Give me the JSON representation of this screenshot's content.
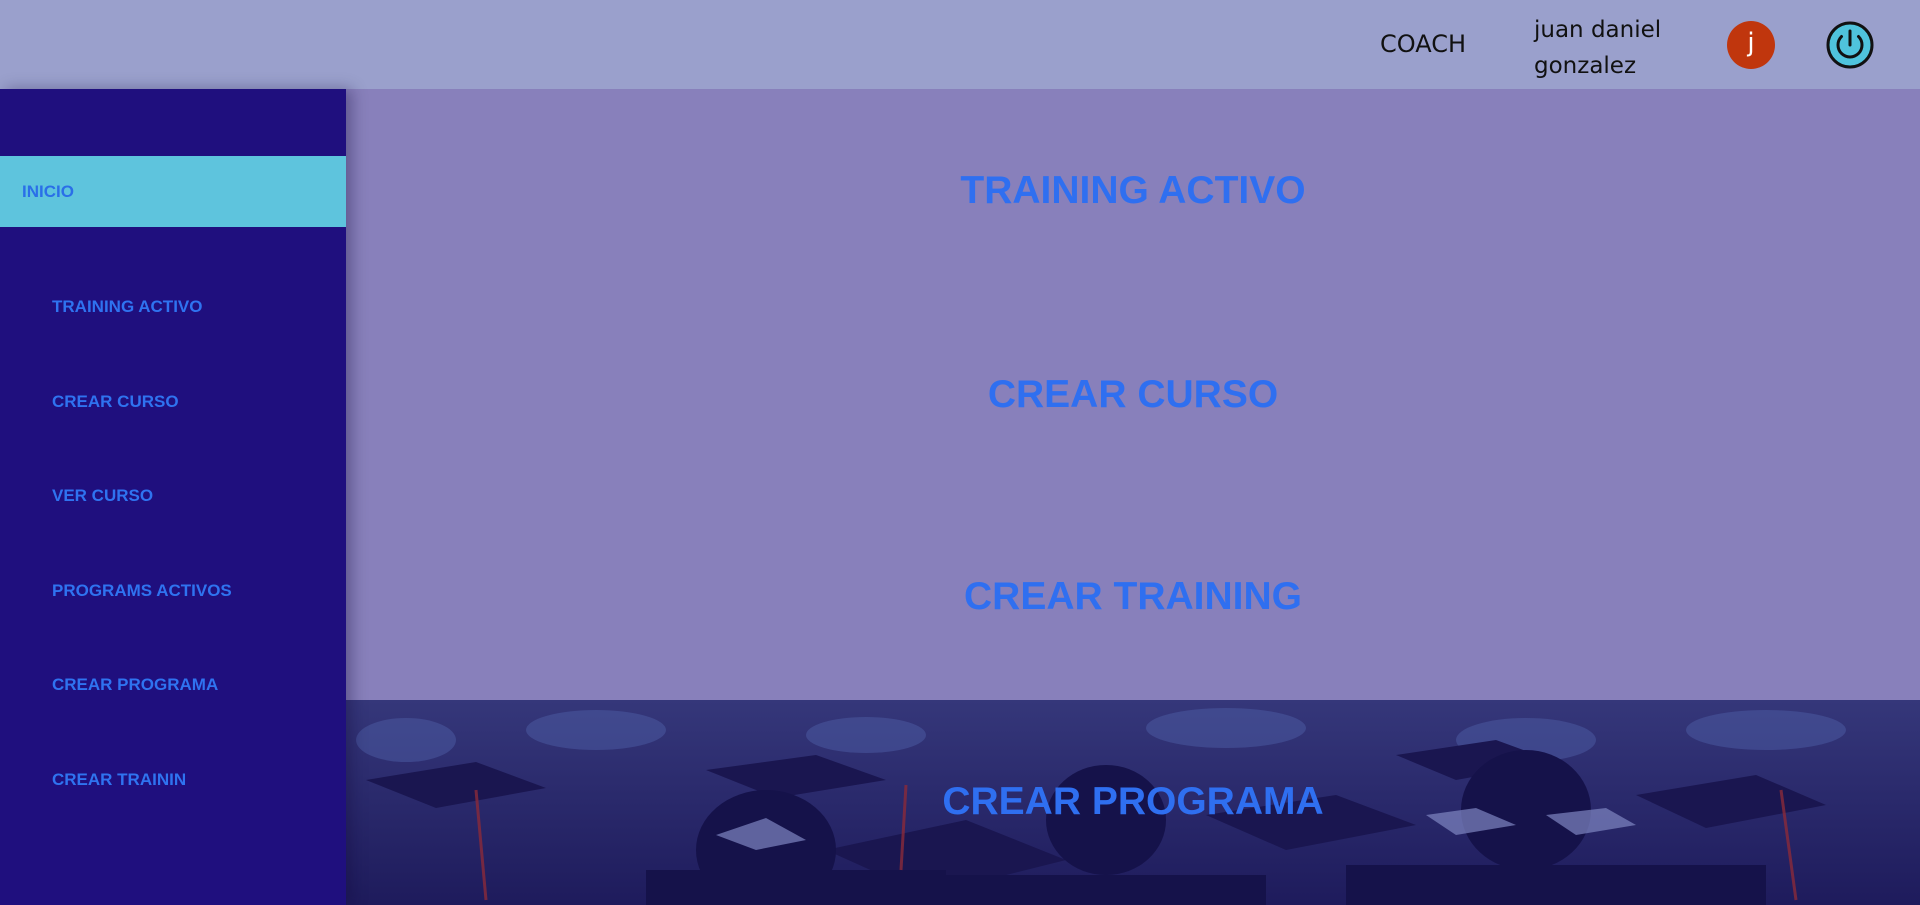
{
  "header": {
    "role": "COACH",
    "user_name": "juan daniel gonzalez",
    "avatar_initial": "j",
    "avatar_color": "#c0360d",
    "power_icon": "power-icon"
  },
  "sidebar": {
    "home_label": "INICIO",
    "items": [
      {
        "label": "TRAINING ACTIVO"
      },
      {
        "label": "CREAR CURSO"
      },
      {
        "label": "VER CURSO"
      },
      {
        "label": "PROGRAMS ACTIVOS"
      },
      {
        "label": "CREAR PROGRAMA"
      },
      {
        "label": "CREAR TRAININ"
      }
    ]
  },
  "main": {
    "cards": [
      {
        "label": "TRAINING ACTIVO"
      },
      {
        "label": "CREAR CURSO"
      },
      {
        "label": "CREAR TRAINING"
      },
      {
        "label": "CREAR PROGRAMA"
      }
    ]
  },
  "colors": {
    "header_bg": "#9aa0cc",
    "sidebar_bg": "#1f0f7e",
    "sidebar_active_bg": "#5ec4dd",
    "main_bg": "#8880bb",
    "link": "#2f6ff0"
  }
}
